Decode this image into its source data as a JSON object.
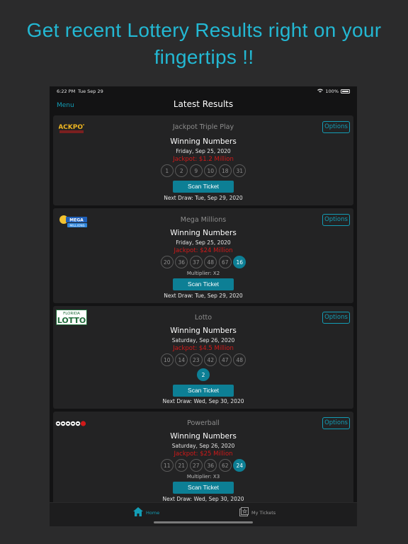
{
  "headline": {
    "line1": "Get recent Lottery Results right on your",
    "line2": "fingertips !!"
  },
  "status_bar": {
    "time": "6:22 PM",
    "date": "Tue Sep 29",
    "battery": "100%"
  },
  "nav": {
    "menu_label": "Menu",
    "title": "Latest Results"
  },
  "common": {
    "winning_label": "Winning Numbers",
    "options_label": "Options",
    "scan_label": "Scan Ticket"
  },
  "cards": [
    {
      "name": "Jackpot Triple Play",
      "logo": "jackpot-logo",
      "date": "Friday, Sep 25, 2020",
      "jackpot": "Jackpot: $1.2 Million",
      "numbers": [
        "1",
        "2",
        "9",
        "10",
        "18",
        "31"
      ],
      "next_draw": "Next Draw: Tue, Sep 29, 2020"
    },
    {
      "name": "Mega Millions",
      "logo": "mega-millions-logo",
      "date": "Friday, Sep 25, 2020",
      "jackpot": "Jackpot: $24 Million",
      "numbers": [
        "20",
        "36",
        "37",
        "48",
        "67"
      ],
      "bonus": "16",
      "multiplier": "Multiplier: X2",
      "next_draw": "Next Draw: Tue, Sep 29, 2020"
    },
    {
      "name": "Lotto",
      "logo": "florida-lotto-logo",
      "logo_text_top": "FLORIDA",
      "logo_text_bottom": "LOTTO",
      "date": "Saturday, Sep 26, 2020",
      "jackpot": "Jackpot: $4.5 Million",
      "numbers": [
        "10",
        "14",
        "23",
        "42",
        "47",
        "48"
      ],
      "bonus": "2",
      "next_draw": "Next Draw: Wed, Sep 30, 2020"
    },
    {
      "name": "Powerball",
      "logo": "powerball-logo",
      "date": "Saturday, Sep 26, 2020",
      "jackpot": "Jackpot: $25 Million",
      "numbers": [
        "11",
        "21",
        "27",
        "36",
        "62"
      ],
      "bonus": "24",
      "multiplier": "Multiplier: X3",
      "next_draw": "Next Draw: Wed, Sep 30, 2020"
    }
  ],
  "tabs": {
    "home": "Home",
    "tickets": "My Tickets"
  },
  "colors": {
    "accent": "#139db5",
    "jackpot_red": "#d11919",
    "headline": "#23b8d3"
  }
}
